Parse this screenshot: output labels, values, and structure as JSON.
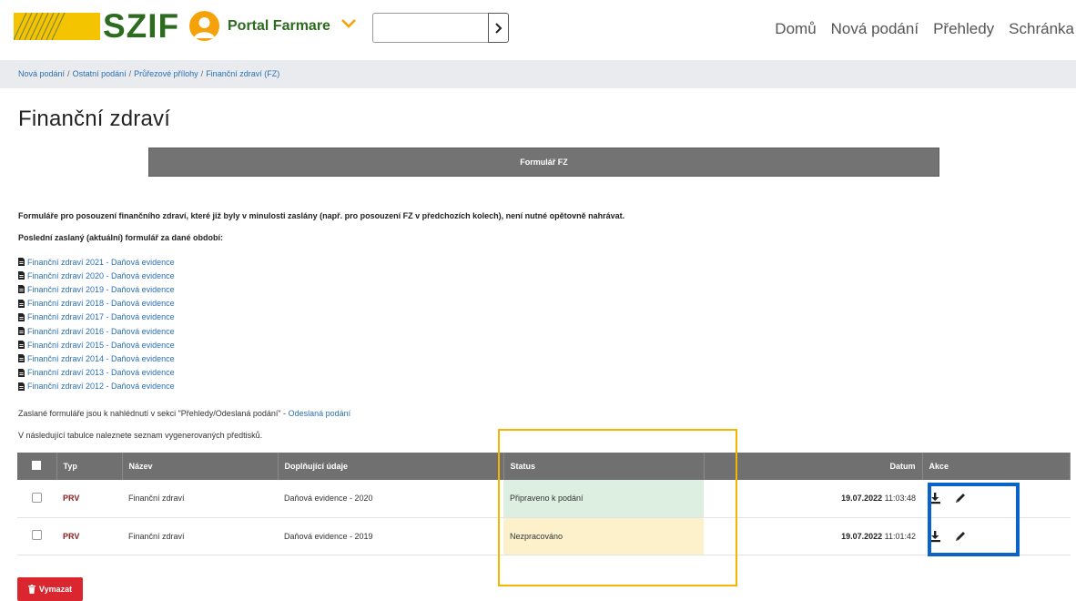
{
  "header": {
    "logo_text": "SZIF",
    "portal_label": "Portal Farmare",
    "search": {
      "value": "",
      "placeholder": ""
    },
    "nav": [
      "Domů",
      "Nová podání",
      "Přehledy",
      "Schránka"
    ]
  },
  "breadcrumb": [
    "Nová podání",
    "Ostatní podání",
    "Průřezové přílohy",
    "Finanční zdraví (FZ)"
  ],
  "page_title": "Finanční zdraví",
  "form_button_label": "Formulář FZ",
  "info": {
    "line1": "Formuláře pro posouzení finančního zdraví, které již byly v minulosti zaslány (např. pro posouzení FZ v předchozích kolech), není nutné opětovně nahrávat.",
    "line2": "Poslední zaslaný (aktuální) formulář za dané období:"
  },
  "documents": [
    "Finanční zdraví 2021 - Daňová evidence",
    "Finanční zdraví 2020 - Daňová evidence",
    "Finanční zdraví 2019 - Daňová evidence",
    "Finanční zdraví 2018 - Daňová evidence",
    "Finanční zdraví 2017 - Daňová evidence",
    "Finanční zdraví 2016 - Daňová evidence",
    "Finanční zdraví 2015 - Daňová evidence",
    "Finanční zdraví 2014 - Daňová evidence",
    "Finanční zdraví 2013 - Daňová evidence",
    "Finanční zdraví 2012 - Daňová evidence"
  ],
  "notes": {
    "sent_text": "Zaslané formuláře jsou k nahlédnutí v sekci \"Přehledy/Odeslaná podání\" - ",
    "sent_link": "Odeslaná podání",
    "table_intro": "V následující tabulce naleznete seznam vygenerovaných předtisků."
  },
  "table": {
    "headers": {
      "typ": "Typ",
      "nazev": "Název",
      "doplnujici": "Doplňující údaje",
      "status": "Status",
      "datum": "Datum",
      "akce": "Akce"
    },
    "rows": [
      {
        "typ": "PRV",
        "nazev": "Finanční zdraví",
        "doplnujici": "Daňová evidence - 2020",
        "status": "Připraveno k podání",
        "status_color": "#dcefe0",
        "date": "19.07.2022",
        "time": "11:03:48"
      },
      {
        "typ": "PRV",
        "nazev": "Finanční zdraví",
        "doplnujici": "Daňová evidence - 2019",
        "status": "Nezpracováno",
        "status_color": "#fdf1cc",
        "date": "19.07.2022",
        "time": "11:01:42"
      }
    ]
  },
  "delete_button_label": "Vymazat",
  "colors": {
    "brand_green": "#2d6b1f",
    "brand_yellow": "#f5b400",
    "header_gray": "#707070",
    "link_blue": "#2a6fb5",
    "danger_red": "#d9262f",
    "highlight_orange": "#f5b400",
    "highlight_blue": "#0a63c6"
  },
  "icons": {
    "logo": "szif-logo-stripes",
    "avatar": "user-avatar-icon",
    "chevron": "chevron-down-icon",
    "search_go": "chevron-right-icon",
    "document": "pdf-document-icon",
    "download": "download-icon",
    "edit": "pencil-icon",
    "delete": "trash-icon"
  }
}
